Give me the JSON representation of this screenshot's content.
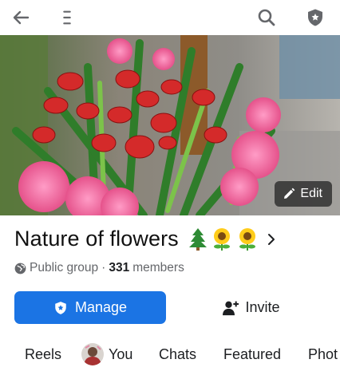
{
  "topbar": {
    "back_icon": "arrow-left-icon",
    "menu_icon": "hamburger-icon",
    "search_icon": "search-icon",
    "admin_icon": "shield-star-icon"
  },
  "cover": {
    "edit_label": "Edit",
    "edit_icon": "pencil-icon"
  },
  "group": {
    "name": "Nature of flowers",
    "emoji": [
      "🌲",
      "🌻",
      "🌻"
    ],
    "privacy_icon": "globe-icon",
    "privacy": "Public group",
    "separator": "·",
    "member_count": "331",
    "members_label": "members"
  },
  "actions": {
    "manage_label": "Manage",
    "invite_label": "Invite"
  },
  "tabs": [
    {
      "label": "Reels"
    },
    {
      "label": "You"
    },
    {
      "label": "Chats"
    },
    {
      "label": "Featured"
    },
    {
      "label": "Phot"
    }
  ],
  "colors": {
    "primary": "#1b74e4",
    "icon_gray": "#65676b",
    "text": "#1c1e21"
  }
}
